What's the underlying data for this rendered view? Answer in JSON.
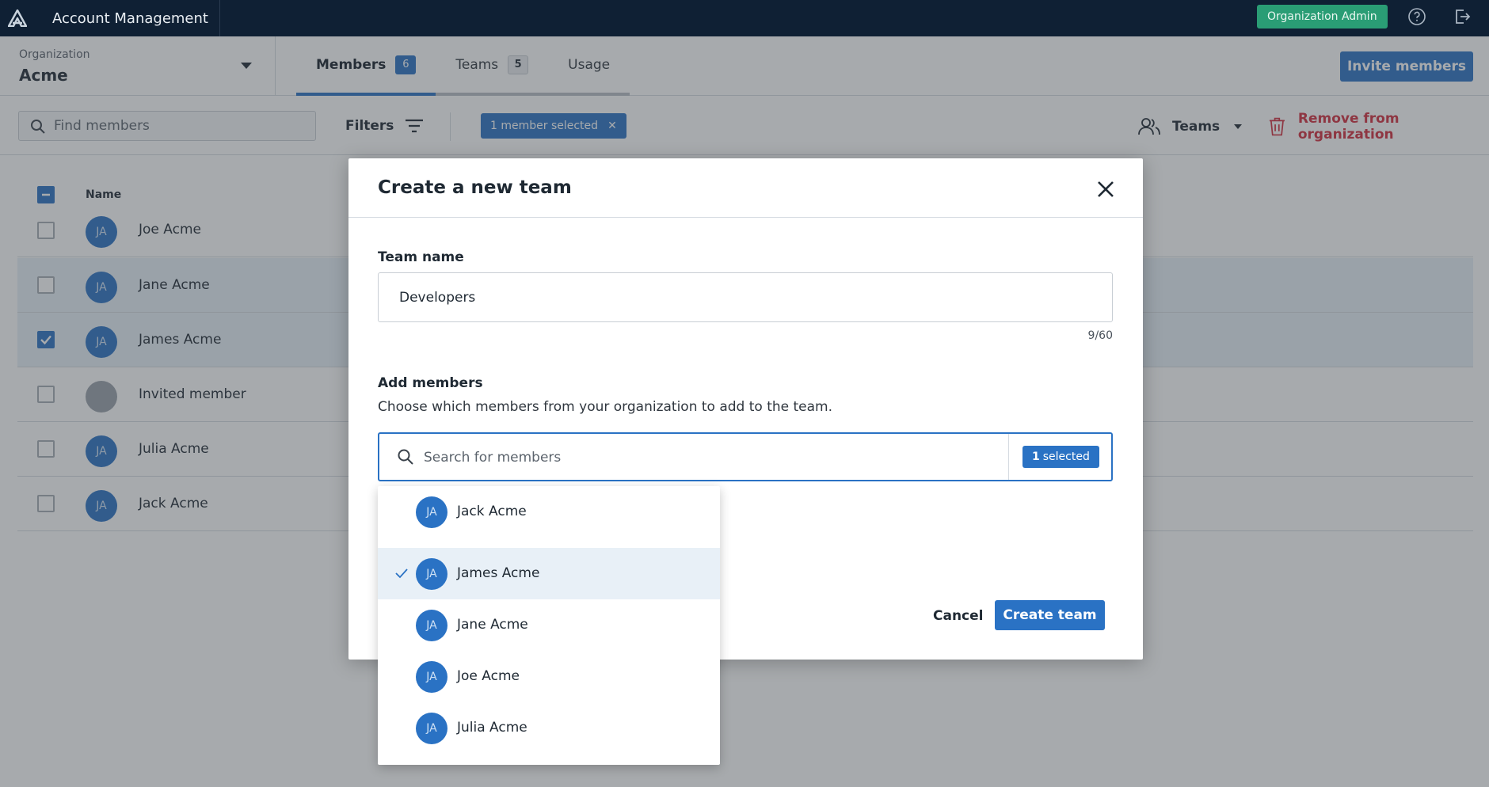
{
  "topbar": {
    "app_title": "Account Management",
    "role_badge": "Organization Admin"
  },
  "header": {
    "org_label": "Organization",
    "org_name": "Acme",
    "tabs": [
      {
        "label": "Members",
        "count": "6"
      },
      {
        "label": "Teams",
        "count": "5"
      },
      {
        "label": "Usage"
      }
    ],
    "invite_label": "Invite members"
  },
  "toolbar": {
    "find_placeholder": "Find members",
    "filters_label": "Filters",
    "selection_chip": "1 member selected",
    "teams_label": "Teams",
    "remove_label": "Remove from organization"
  },
  "table": {
    "name_header": "Name",
    "rows": [
      {
        "initials": "JA",
        "name": "Joe Acme",
        "checked": false
      },
      {
        "initials": "JA",
        "name": "Jane Acme",
        "checked": false
      },
      {
        "initials": "JA",
        "name": "James Acme",
        "checked": true
      },
      {
        "initials": "",
        "name": "Invited member",
        "checked": false
      },
      {
        "initials": "JA",
        "name": "Julia Acme",
        "checked": false
      },
      {
        "initials": "JA",
        "name": "Jack Acme",
        "checked": false
      }
    ]
  },
  "modal": {
    "title": "Create a new team",
    "team_name_label": "Team name",
    "team_name_value": "Developers",
    "char_counter": "9/60",
    "add_members_label": "Add members",
    "add_members_desc": "Choose which members from your organization to add to the team.",
    "search_placeholder": "Search for members",
    "selected_count": "1",
    "selected_suffix": "selected",
    "cancel_label": "Cancel",
    "create_label": "Create team"
  },
  "member_options": [
    {
      "initials": "JA",
      "name": "Jack Acme",
      "selected": false
    },
    {
      "initials": "JA",
      "name": "James Acme",
      "selected": true
    },
    {
      "initials": "JA",
      "name": "Jane Acme",
      "selected": false
    },
    {
      "initials": "JA",
      "name": "Joe Acme",
      "selected": false
    },
    {
      "initials": "JA",
      "name": "Julia Acme",
      "selected": false
    }
  ],
  "colors": {
    "topbar_bg": "#0f2034",
    "accent": "#2a72c4",
    "admin_badge": "#2a9d75",
    "danger": "#d22d3c"
  }
}
